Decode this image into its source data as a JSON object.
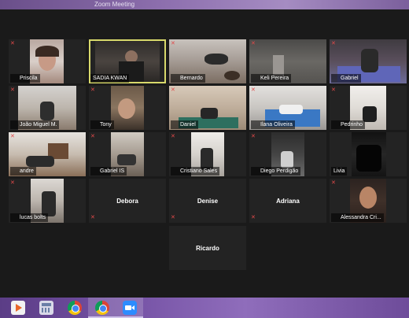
{
  "window": {
    "title": "Zoom Meeting"
  },
  "participants": [
    {
      "name": "Priscila",
      "muted": true
    },
    {
      "name": "SADIA KWAN",
      "muted": false,
      "active": true
    },
    {
      "name": "Bernardo",
      "muted": true
    },
    {
      "name": "Keli Pereira",
      "muted": true
    },
    {
      "name": "Gabriel",
      "muted": true
    },
    {
      "name": "João Miguel M.",
      "muted": true
    },
    {
      "name": "Tony",
      "muted": true
    },
    {
      "name": "Daniel",
      "muted": true
    },
    {
      "name": "Ilana Oliveira",
      "muted": true
    },
    {
      "name": "Pedrinho",
      "muted": true
    },
    {
      "name": "andre",
      "muted": true
    },
    {
      "name": "Gabriel IS",
      "muted": true
    },
    {
      "name": "Cristiano Sales",
      "muted": true
    },
    {
      "name": "Diego Perdigão",
      "muted": true
    },
    {
      "name": "Livia",
      "muted": false
    },
    {
      "name": "lucas bolts",
      "muted": true
    },
    {
      "name": "Debora",
      "muted": true,
      "no_video": true
    },
    {
      "name": "Denise",
      "muted": true,
      "no_video": true
    },
    {
      "name": "Adriana",
      "muted": true,
      "no_video": true
    },
    {
      "name": "Alessandra Cri...",
      "muted": true
    },
    {
      "name": "Ricardo",
      "muted": false,
      "no_video": true
    }
  ],
  "taskbar": {
    "icons": [
      "media-player-icon",
      "calculator-icon",
      "chrome-icon",
      "chrome-icon",
      "zoom-icon"
    ]
  },
  "colors": {
    "active_border": "#d8d96b",
    "muted_mic": "#e34a4a",
    "tile_bg": "#232323"
  }
}
